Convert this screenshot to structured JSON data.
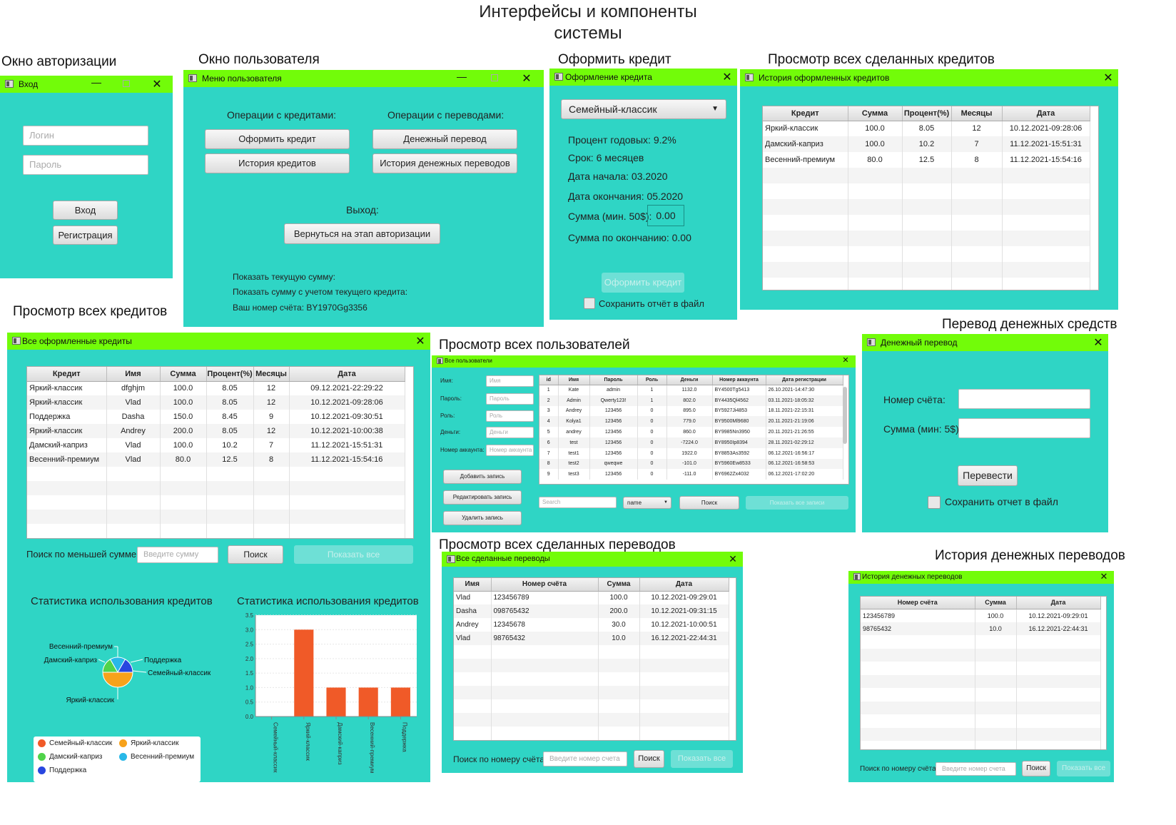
{
  "page_title_line1": "Интерфейсы и компоненты",
  "page_title_line2": "системы",
  "sections": {
    "auth": "Окно авторизации",
    "user": "Окно пользователя",
    "credit": "Оформить кредит",
    "history_all": "Просмотр всех сделанных кредитов",
    "all_credits": "Просмотр всех кредитов",
    "all_users": "Просмотр всех пользователей",
    "transfer": "Перевод денежных средств",
    "all_transfers": "Просмотр всех сделанных переводов",
    "transfer_history": "История денежных переводов"
  },
  "login": {
    "title": "Вход",
    "login_ph": "Логин",
    "pass_ph": "Пароль",
    "enter": "Вход",
    "register": "Регистрация"
  },
  "menu": {
    "title": "Меню пользователя",
    "credit_ops": "Операции с кредитами:",
    "transfer_ops": "Операции с переводами:",
    "take_credit": "Оформить кредит",
    "credit_history": "История кредитов",
    "money_transfer": "Денежный перевод",
    "transfer_history": "История денежных переводов",
    "exit_label": "Выход:",
    "back": "Вернуться на этап авторизации",
    "show_sum": "Показать текущую сумму:",
    "show_sum_credit": "Показать сумму с учетом текущего кредита:",
    "account": "Ваш номер счёта:  BY1970Gg3356"
  },
  "credit_form": {
    "title": "Оформление кредита",
    "selected": "Семейный-классик",
    "rate": "Процент годовых: 9.2%",
    "term": "Срок:  6 месяцев",
    "start": "Дата начала: 03.2020",
    "end": "Дата окончания: 05.2020",
    "sum_label": "Сумма (мин. 50$):",
    "sum_value": "0.00",
    "sum_end": "Сумма по окончанию:  0.00",
    "submit": "Оформить кредит",
    "save": "Сохранить отчёт в файл"
  },
  "history": {
    "title": "История оформленных кредитов",
    "headers": [
      "Кредит",
      "Сумма",
      "Процент(%)",
      "Месяцы",
      "Дата"
    ],
    "rows": [
      [
        "Яркий-классик",
        "100.0",
        "8.05",
        "12",
        "10.12.2021-09:28:06"
      ],
      [
        "Дамский-каприз",
        "100.0",
        "10.2",
        "7",
        "11.12.2021-15:51:31"
      ],
      [
        "Весенний-премиум",
        "80.0",
        "12.5",
        "8",
        "11.12.2021-15:54:16"
      ]
    ]
  },
  "all_credits": {
    "title": "Все оформленные кредиты",
    "headers": [
      "Кредит",
      "Имя",
      "Сумма",
      "Процент(%)",
      "Месяцы",
      "Дата"
    ],
    "rows": [
      [
        "Яркий-классик",
        "dfghjm",
        "100.0",
        "8.05",
        "12",
        "09.12.2021-22:29:22"
      ],
      [
        "Яркий-классик",
        "Vlad",
        "100.0",
        "8.05",
        "12",
        "10.12.2021-09:28:06"
      ],
      [
        "Поддержка",
        "Dasha",
        "150.0",
        "8.45",
        "9",
        "10.12.2021-09:30:51"
      ],
      [
        "Яркий-классик",
        "Andrey",
        "200.0",
        "8.05",
        "12",
        "10.12.2021-10:00:38"
      ],
      [
        "Дамский-каприз",
        "Vlad",
        "100.0",
        "10.2",
        "7",
        "11.12.2021-15:51:31"
      ],
      [
        "Весенний-премиум",
        "Vlad",
        "80.0",
        "12.5",
        "8",
        "11.12.2021-15:54:16"
      ]
    ],
    "search_label": "Поиск по меньшей сумме:",
    "search_ph": "Введите сумму",
    "search_btn": "Поиск",
    "show_all": "Показать все",
    "pie_title": "Статистика использования кредитов",
    "bar_title": "Статистика использования кредитов",
    "pie_labels": [
      "Весенний-премиум",
      "Дамский-каприз",
      "Поддержка",
      "Семейный-классик",
      "Яркий-классик"
    ],
    "legend": [
      {
        "name": "Семейный-классик",
        "color": "#f05a28"
      },
      {
        "name": "Яркий-классик",
        "color": "#f7a21b"
      },
      {
        "name": "Дамский-каприз",
        "color": "#50d34a"
      },
      {
        "name": "Весенний-премиум",
        "color": "#28b8e8"
      },
      {
        "name": "Поддержка",
        "color": "#2846e0"
      }
    ]
  },
  "chart_data": {
    "type": "bar",
    "title": "Статистика использования кредитов",
    "categories": [
      "Семейный-классик",
      "Яркий-классик",
      "Дамский-каприз",
      "Весенний-премиум",
      "Поддержка"
    ],
    "values": [
      0,
      3,
      1,
      1,
      1
    ],
    "ylim": [
      0,
      3.5
    ],
    "yticks": [
      "0.0",
      "0.5",
      "1.0",
      "1.5",
      "2.0",
      "2.5",
      "3.0",
      "3.5"
    ],
    "bar_color": "#f05a28",
    "grid": true
  },
  "users": {
    "title": "Все пользователи",
    "form_labels": [
      "Имя:",
      "Пароль:",
      "Роль:",
      "Деньги:",
      "Номер аккаунта:"
    ],
    "form_ph": [
      "Имя",
      "Пароль",
      "Роль",
      "Деньги",
      "Номер аккаунта"
    ],
    "add": "Добавить запись",
    "edit": "Редактировать запись",
    "delete": "Удалить запись",
    "headers": [
      "id",
      "Имя",
      "Пароль",
      "Роль",
      "Деньги",
      "Номер аккаунта",
      "Дата регистрации"
    ],
    "rows": [
      [
        "1",
        "Kate",
        "admin",
        "1",
        "1132.0",
        "BY4500Tg5413",
        "26.10.2021-14:47:30"
      ],
      [
        "2",
        "Admin",
        "Qwerty123!",
        "1",
        "802.0",
        "BY4435Ql4562",
        "03.11.2021-18:05:32"
      ],
      [
        "3",
        "Andrey",
        "123456",
        "0",
        "895.0",
        "BY5927Ji4853",
        "18.11.2021-22:15:31"
      ],
      [
        "4",
        "Kolya1",
        "123456",
        "0",
        "779.0",
        "BY9500Ml9680",
        "20.11.2021-21:19:06"
      ],
      [
        "5",
        "andrey",
        "123456",
        "0",
        "860.0",
        "BY9985Nn3950",
        "20.11.2021-21:26:55"
      ],
      [
        "6",
        "test",
        "123456",
        "0",
        "-7224.0",
        "BY8950Ip8394",
        "28.11.2021-02:29:12"
      ],
      [
        "7",
        "test1",
        "123456",
        "0",
        "1922.0",
        "BY8853As3592",
        "06.12.2021-16:56:17"
      ],
      [
        "8",
        "test2",
        "qweqwe",
        "0",
        "-101.0",
        "BY5960Ew8533",
        "06.12.2021-16:58:53"
      ],
      [
        "9",
        "test3",
        "123456",
        "0",
        "-111.0",
        "BY6962Zx4032",
        "06.12.2021-17:02:20"
      ]
    ],
    "search_ph": "Search",
    "filter": "name",
    "search_btn": "Поиск",
    "show_all": "Показать все записи"
  },
  "transfer": {
    "title": "Денежный перевод",
    "account_label": "Номер счёта:",
    "sum_label": "Сумма (мин: 5$):",
    "send": "Перевести",
    "save": "Сохранить отчет в файл"
  },
  "transfers": {
    "title": "Все сделанные переводы",
    "headers": [
      "Имя",
      "Номер счёта",
      "Сумма",
      "Дата"
    ],
    "rows": [
      [
        "Vlad",
        "123456789",
        "100.0",
        "10.12.2021-09:29:01"
      ],
      [
        "Dasha",
        "098765432",
        "200.0",
        "10.12.2021-09:31:15"
      ],
      [
        "Andrey",
        "12345678",
        "30.0",
        "10.12.2021-10:00:51"
      ],
      [
        "Vlad",
        "98765432",
        "10.0",
        "16.12.2021-22:44:31"
      ]
    ],
    "search_label": "Поиск по номеру счёта:",
    "search_ph": "Введите номер счета",
    "search_btn": "Поиск",
    "show_all": "Показать все"
  },
  "thistory": {
    "title": "История денежных переводов",
    "headers": [
      "Номер счёта",
      "Сумма",
      "Дата"
    ],
    "rows": [
      [
        "123456789",
        "100.0",
        "10.12.2021-09:29:01"
      ],
      [
        "98765432",
        "10.0",
        "16.12.2021-22:44:31"
      ]
    ],
    "search_label": "Поиск по номеру счёта:",
    "search_ph": "Введите номер счета",
    "search_btn": "Поиск",
    "show_all": "Показать все"
  }
}
